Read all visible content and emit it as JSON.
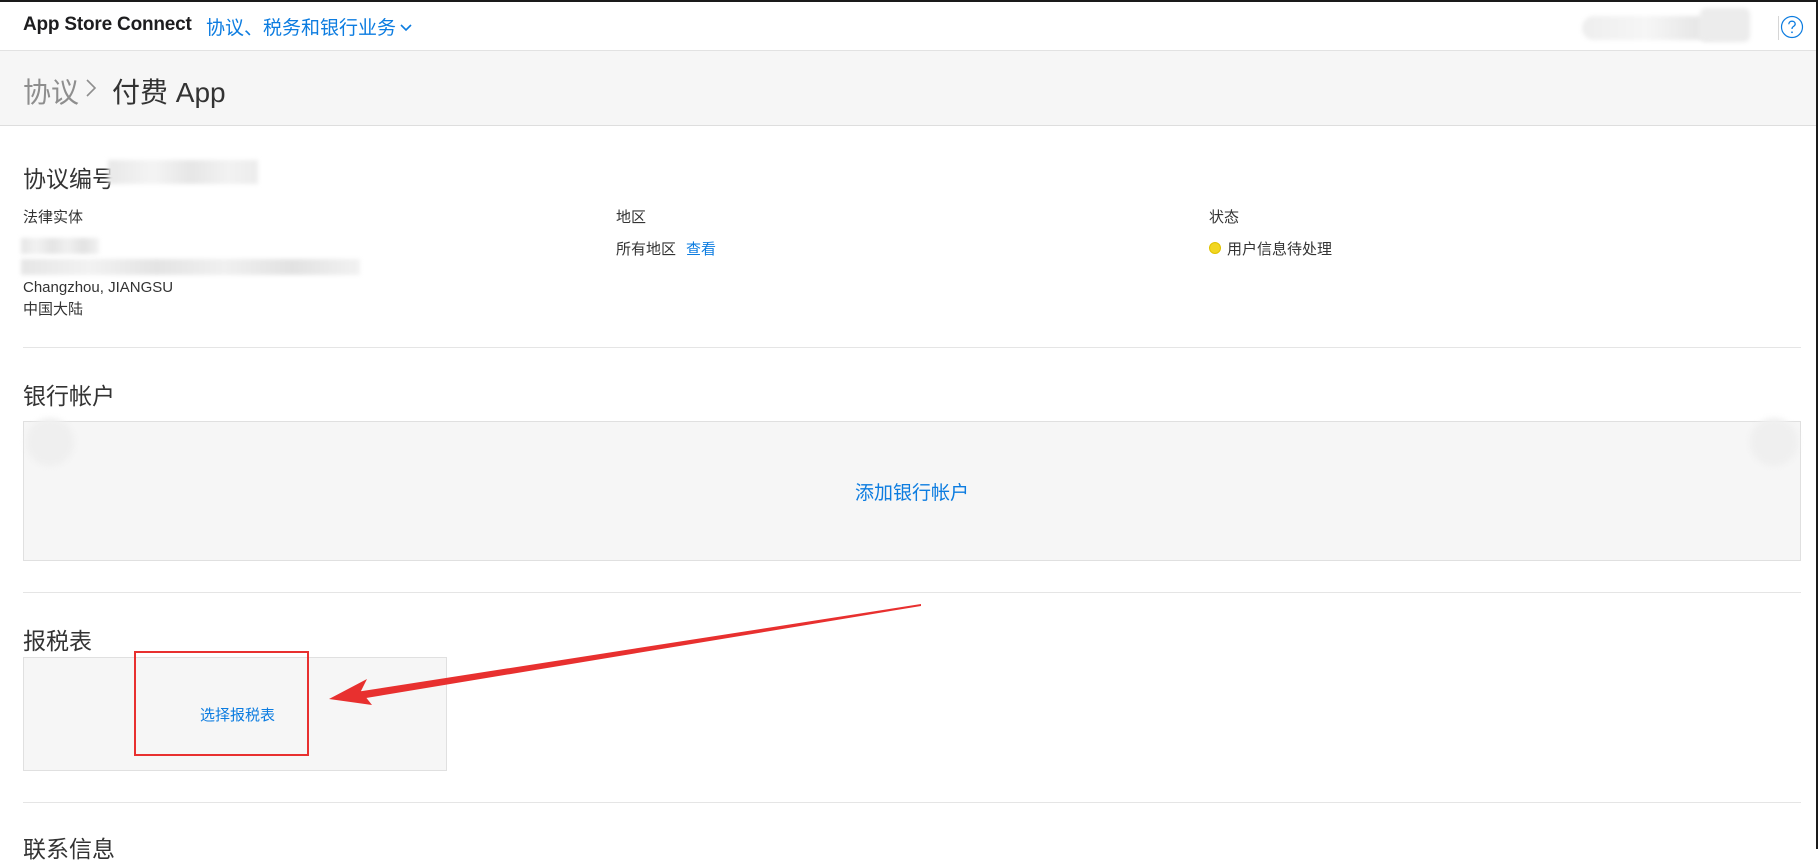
{
  "topbar": {
    "app_title": "App Store Connect",
    "section_menu": "协议、税务和银行业务"
  },
  "breadcrumb": {
    "parent": "协议",
    "current": "付费 App"
  },
  "agreement": {
    "title": "协议编号",
    "legal_entity_label": "法律实体",
    "city_region": "Changzhou, JIANGSU",
    "country": "中国大陆",
    "region_label": "地区",
    "region_value": "所有地区",
    "region_link": "查看",
    "status_label": "状态",
    "status_value": "用户信息待处理"
  },
  "bank": {
    "title": "银行帐户",
    "add_label": "添加银行帐户"
  },
  "tax": {
    "title": "报税表",
    "choose_label": "选择报税表"
  },
  "contact": {
    "title": "联系信息"
  },
  "colors": {
    "link": "#0c7ce0",
    "status_pending": "#f2d622",
    "annotation": "#e8302f"
  }
}
